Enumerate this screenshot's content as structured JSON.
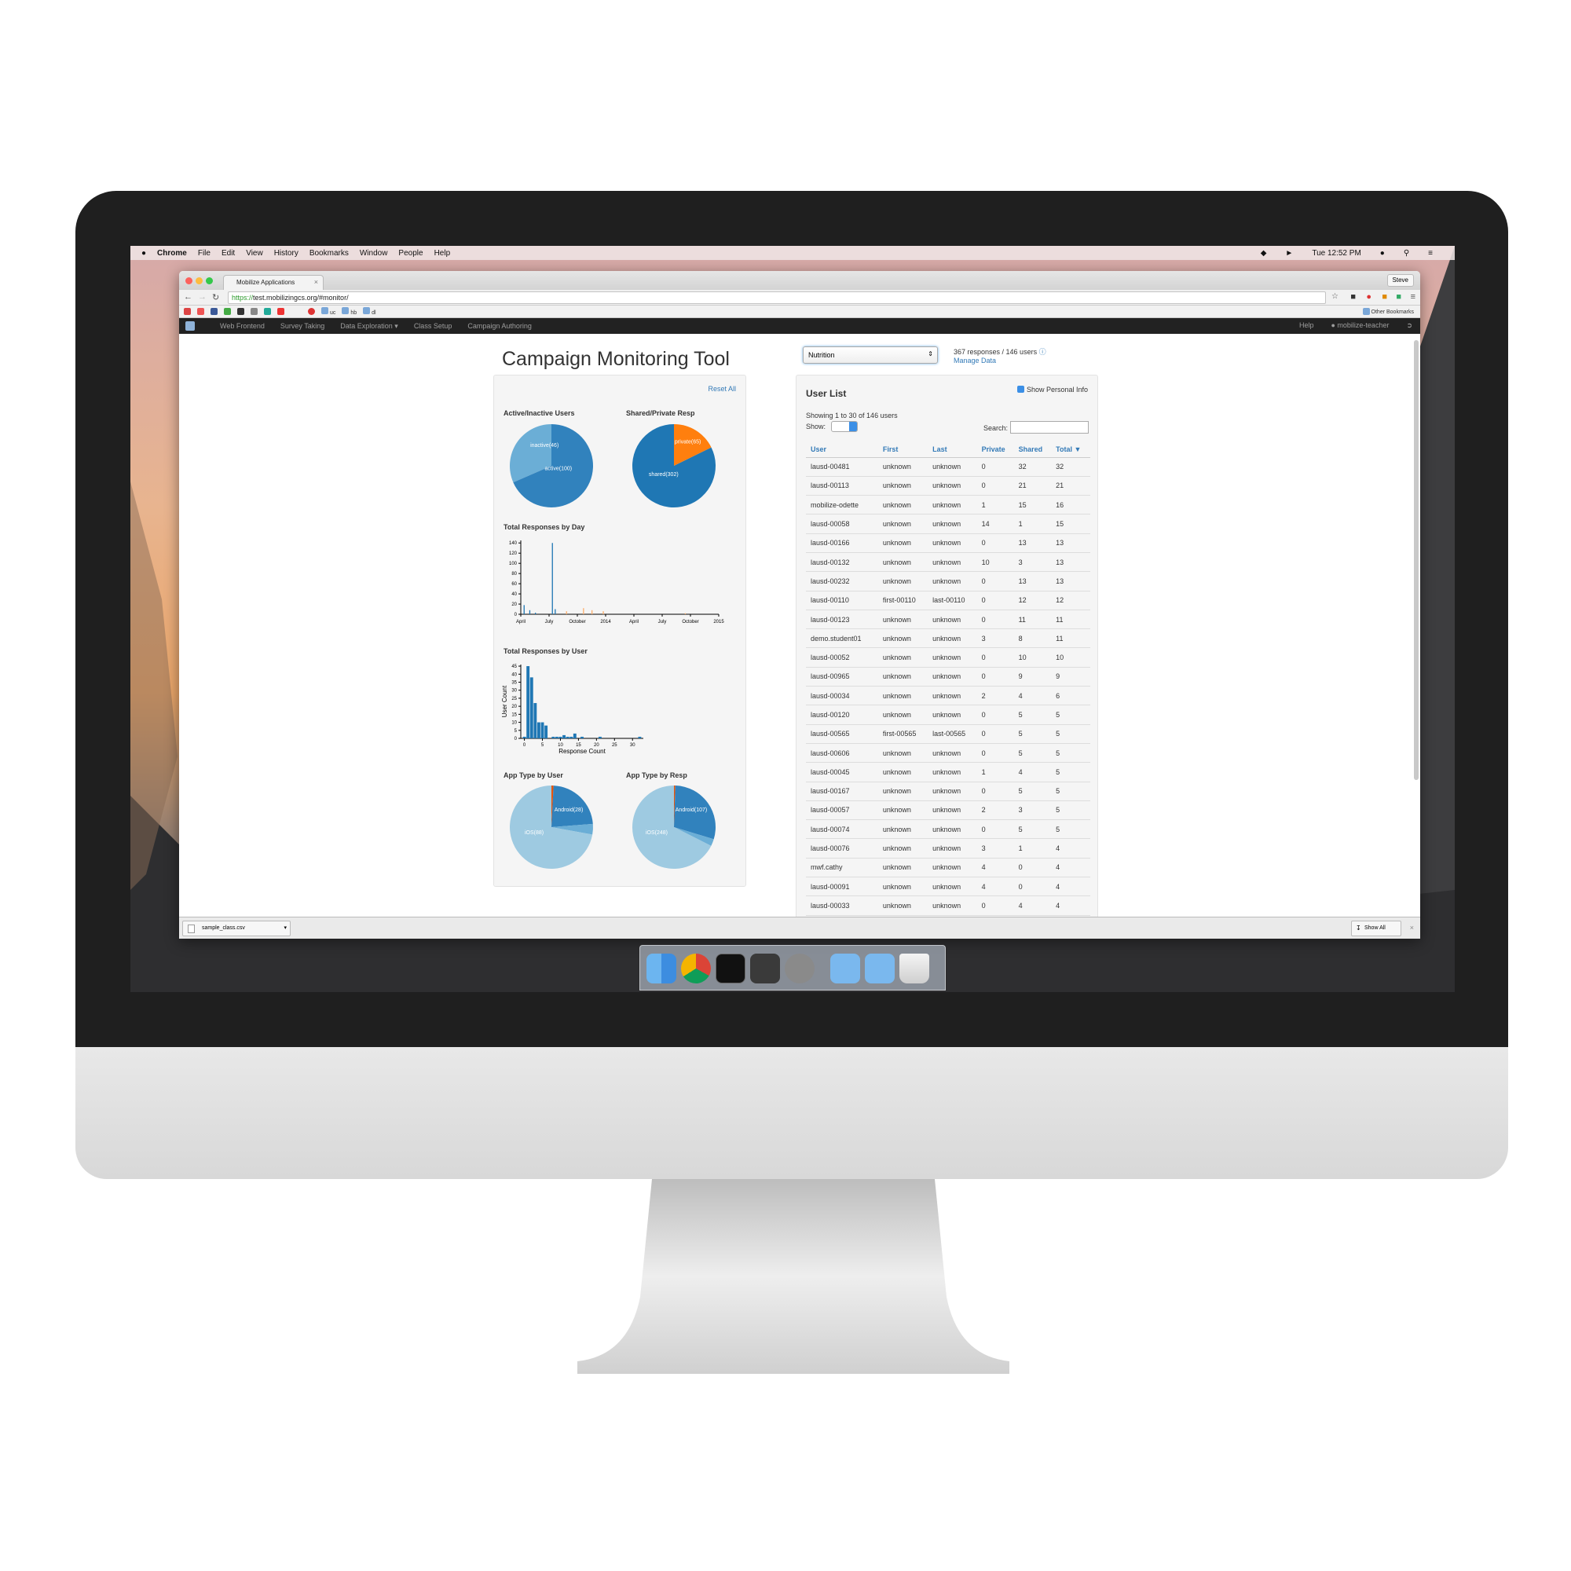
{
  "menubar": {
    "app": "Chrome",
    "items": [
      "File",
      "Edit",
      "View",
      "History",
      "Bookmarks",
      "Window",
      "People",
      "Help"
    ],
    "clock": "Tue 12:52 PM"
  },
  "browser": {
    "tab_title": "Mobilize Applications",
    "tab_close": "×",
    "profile": "Steve",
    "url_scheme": "https://",
    "url_rest": "test.mobilizingcs.org/#monitor/",
    "bookmark_folders": [
      "uc",
      "hb",
      "dl"
    ],
    "other_bookmarks": "Other Bookmarks",
    "download_file": "sample_class.csv",
    "download_caret": "▾",
    "download_close": "×",
    "show_all": "Show All"
  },
  "appnav": {
    "items": [
      "Web Frontend",
      "Survey Taking",
      "Data Exploration ▾",
      "Class Setup",
      "Campaign Authoring"
    ],
    "help": "Help",
    "user": "mobilize-teacher"
  },
  "page": {
    "title": "Campaign Monitoring Tool",
    "reset_all": "Reset All",
    "campaign_selected": "Nutrition",
    "select_arrow": "⇕",
    "stats": "367 responses / 146 users",
    "manage_data": "Manage Data"
  },
  "charts": {
    "active_title": "Active/Inactive Users",
    "shared_title": "Shared/Private Resp",
    "by_day_title": "Total Responses by Day",
    "by_user_title": "Total Responses by User",
    "apptype_user_title": "App Type by User",
    "apptype_resp_title": "App Type by Resp"
  },
  "chart_data": [
    {
      "type": "pie",
      "title": "Active/Inactive Users",
      "labels": [
        "inactive(46)",
        "active(100)"
      ],
      "values": [
        46,
        100
      ],
      "colors": [
        "#6baed6",
        "#3182bd"
      ]
    },
    {
      "type": "pie",
      "title": "Shared/Private Resp",
      "labels": [
        "private(65)",
        "shared(302)"
      ],
      "values": [
        65,
        302
      ],
      "colors": [
        "#ff7f0e",
        "#1f77b4"
      ]
    },
    {
      "type": "bar",
      "title": "Total Responses by Day",
      "x_ticks": [
        "April",
        "July",
        "October",
        "2014",
        "April",
        "July",
        "October",
        "2015"
      ],
      "y_ticks": [
        0,
        20,
        40,
        60,
        80,
        100,
        120,
        140
      ],
      "ylim": [
        0,
        145
      ],
      "series": [
        {
          "color": "#1f77b4",
          "bars": [
            {
              "x": 0.1,
              "y": 18
            },
            {
              "x": 0.3,
              "y": 8
            },
            {
              "x": 0.5,
              "y": 3
            },
            {
              "x": 1.1,
              "y": 140
            },
            {
              "x": 1.2,
              "y": 10
            }
          ]
        },
        {
          "color": "#fdae6b",
          "bars": [
            {
              "x": 1.6,
              "y": 6
            },
            {
              "x": 2.2,
              "y": 12
            },
            {
              "x": 2.5,
              "y": 8
            },
            {
              "x": 2.9,
              "y": 6
            },
            {
              "x": 5.8,
              "y": 2
            }
          ]
        }
      ]
    },
    {
      "type": "bar",
      "title": "Total Responses by User",
      "xlabel": "Response Count",
      "ylabel": "User Count",
      "x_ticks": [
        0,
        5,
        10,
        15,
        20,
        25,
        30
      ],
      "y_ticks": [
        0,
        5,
        10,
        15,
        20,
        25,
        30,
        35,
        40,
        45
      ],
      "ylim": [
        0,
        46
      ],
      "xlim": [
        -1,
        33
      ],
      "x": [
        0,
        1,
        2,
        3,
        4,
        5,
        6,
        8,
        9,
        10,
        11,
        12,
        13,
        14,
        16,
        21,
        32
      ],
      "values": [
        1,
        45,
        38,
        22,
        10,
        10,
        8,
        1,
        1,
        1,
        2,
        1,
        1,
        3,
        1,
        1,
        1
      ]
    },
    {
      "type": "pie",
      "title": "App Type by User",
      "labels": [
        "Android(28)",
        "iOS(88)"
      ],
      "values": [
        1,
        28,
        5,
        88
      ],
      "colors": [
        "#e6550d",
        "#3182bd",
        "#6baed6",
        "#9ecae1"
      ]
    },
    {
      "type": "pie",
      "title": "App Type by Resp",
      "labels": [
        "Android(107)",
        "iOS(248)"
      ],
      "values": [
        2,
        107,
        10,
        248
      ],
      "colors": [
        "#e6550d",
        "#3182bd",
        "#6baed6",
        "#9ecae1"
      ]
    }
  ],
  "userlist": {
    "title": "User List",
    "show_personal": "Show Personal Info",
    "showing": "Showing 1 to 30 of 146 users",
    "show_label": "Show:",
    "search_label": "Search:",
    "columns": [
      "User",
      "First",
      "Last",
      "Private",
      "Shared",
      "Total ▼"
    ],
    "rows": [
      [
        "lausd-00481",
        "unknown",
        "unknown",
        "0",
        "32",
        "32"
      ],
      [
        "lausd-00113",
        "unknown",
        "unknown",
        "0",
        "21",
        "21"
      ],
      [
        "mobilize-odette",
        "unknown",
        "unknown",
        "1",
        "15",
        "16"
      ],
      [
        "lausd-00058",
        "unknown",
        "unknown",
        "14",
        "1",
        "15"
      ],
      [
        "lausd-00166",
        "unknown",
        "unknown",
        "0",
        "13",
        "13"
      ],
      [
        "lausd-00132",
        "unknown",
        "unknown",
        "10",
        "3",
        "13"
      ],
      [
        "lausd-00232",
        "unknown",
        "unknown",
        "0",
        "13",
        "13"
      ],
      [
        "lausd-00110",
        "first-00110",
        "last-00110",
        "0",
        "12",
        "12"
      ],
      [
        "lausd-00123",
        "unknown",
        "unknown",
        "0",
        "11",
        "11"
      ],
      [
        "demo.student01",
        "unknown",
        "unknown",
        "3",
        "8",
        "11"
      ],
      [
        "lausd-00052",
        "unknown",
        "unknown",
        "0",
        "10",
        "10"
      ],
      [
        "lausd-00965",
        "unknown",
        "unknown",
        "0",
        "9",
        "9"
      ],
      [
        "lausd-00034",
        "unknown",
        "unknown",
        "2",
        "4",
        "6"
      ],
      [
        "lausd-00120",
        "unknown",
        "unknown",
        "0",
        "5",
        "5"
      ],
      [
        "lausd-00565",
        "first-00565",
        "last-00565",
        "0",
        "5",
        "5"
      ],
      [
        "lausd-00606",
        "unknown",
        "unknown",
        "0",
        "5",
        "5"
      ],
      [
        "lausd-00045",
        "unknown",
        "unknown",
        "1",
        "4",
        "5"
      ],
      [
        "lausd-00167",
        "unknown",
        "unknown",
        "0",
        "5",
        "5"
      ],
      [
        "lausd-00057",
        "unknown",
        "unknown",
        "2",
        "3",
        "5"
      ],
      [
        "lausd-00074",
        "unknown",
        "unknown",
        "0",
        "5",
        "5"
      ],
      [
        "lausd-00076",
        "unknown",
        "unknown",
        "3",
        "1",
        "4"
      ],
      [
        "mwf.cathy",
        "unknown",
        "unknown",
        "4",
        "0",
        "4"
      ],
      [
        "lausd-00091",
        "unknown",
        "unknown",
        "4",
        "0",
        "4"
      ],
      [
        "lausd-00033",
        "unknown",
        "unknown",
        "0",
        "4",
        "4"
      ]
    ]
  },
  "colors": {
    "accent": "#337ab7",
    "navbar": "#222222",
    "pie_blue": "#3182bd",
    "pie_orange": "#ff7f0e"
  }
}
